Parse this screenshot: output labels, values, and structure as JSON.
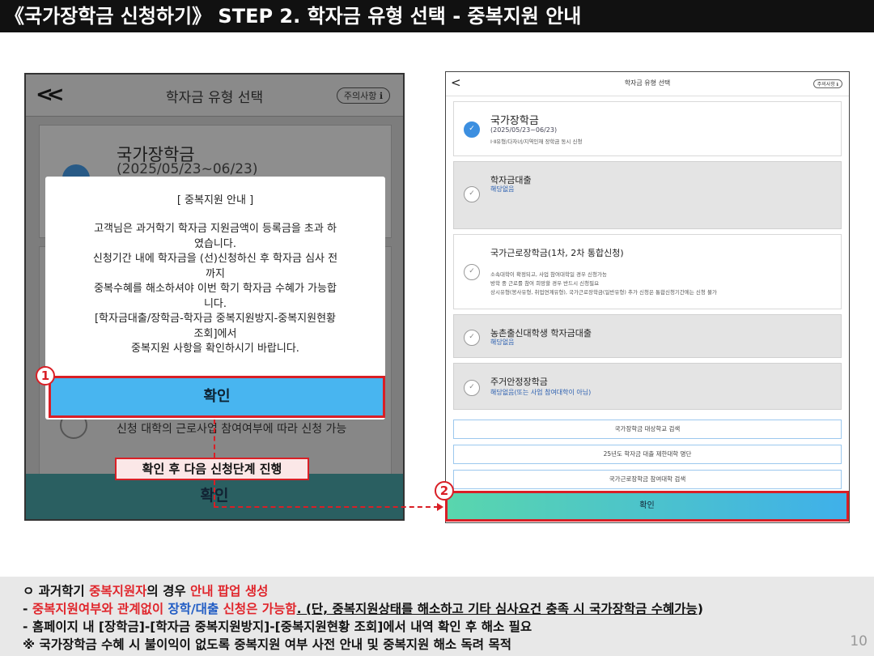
{
  "header": {
    "title": "《국가장학금 신청하기》 STEP 2. 학자금 유형 선택 - 중복지원 안내"
  },
  "left_screen": {
    "back": "<<",
    "title": "학자금 유형 선택",
    "notice_button": "주의사항 ℹ",
    "card_name": "국가장학금",
    "card_date": "(2025/05/23~06/23)",
    "bg_text": "신청 대학의 근로사업 참여여부에 따라 신청 가능",
    "bg_confirm": "확인",
    "modal": {
      "title": "[ 중복지원 안내 ]",
      "body_lines": [
        "고객님은 과거학기 학자금 지원금액이 등록금을 초과 하",
        "였습니다.",
        "신청기간 내에 학자금을 (선)신청하신 후 학자금 심사 전",
        "까지",
        "중복수혜를 해소하셔야 이번 학기 학자금 수혜가 가능합",
        "니다.",
        "[학자금대출/장학금-학자금 중복지원방지-중복지원현황",
        "조회]에서",
        "중복지원 사항을 확인하시기 바랍니다."
      ],
      "confirm": "확인"
    }
  },
  "annotations": {
    "badge1": "1",
    "badge2": "2",
    "callout": "확인 후 다음 신청단계 진행"
  },
  "right_screen": {
    "back": "<",
    "title": "학자금 유형 선택",
    "notice_button": "주의사항 ℹ",
    "cards": [
      {
        "name": "국가장학금",
        "sub": "(2025/05/23~06/23)",
        "desc": "Ⅰ·Ⅱ유형/다자녀/지역인재 장학금 동시 신청",
        "checked": true
      },
      {
        "name": "학자금대출",
        "sub": "해당없음",
        "checked": false
      },
      {
        "name": "국가근로장학금(1차, 2차 통합신청)",
        "desc_lines": [
          "소속대학이 확정되고, 사업 참여대학일 경우 신청가능",
          "방학 중 근로를 참여 희망할 경우 반드시 신청필요",
          "상시유형(봉사유형, 취업연계유형), 국가근로장학금(일반유형) 추가 신청은 통합신청기간에는 신청 불가"
        ],
        "checked": false
      },
      {
        "name": "농촌출신대학생 학자금대출",
        "sub": "해당없음",
        "checked": false
      },
      {
        "name": "주거안정장학금",
        "sub": "해당없음(또는 사업 참여대학이 아님)",
        "checked": false
      }
    ],
    "links": [
      "국가장학금 대상학교 검색",
      "25년도 학자금 대출 제한대학 명단",
      "국가근로장학금 참여대학 검색"
    ],
    "confirm": "확인"
  },
  "notes": {
    "l1": {
      "bullet": "ㅇ 과거학기 ",
      "a": "중복지원자",
      "b": "의 경우 ",
      "c": "안내 팝업 생성"
    },
    "l2": {
      "a": " - ",
      "b": "중복지원여부와 관계없이 ",
      "c": "장학/대출",
      "d": " 신청은 가능함",
      "e": ". (단, 중복지원상태를 해소하고 기타 심사요건 충족 시 ",
      "f": "국가장학금 수혜가능",
      "g": ")"
    },
    "l3": " - 홈페이지 내 [장학금]-[학자금 중복지원방지]-[중복지원현황 조회]에서 내역 확인 후 해소 필요",
    "l4": " ※ 국가장학금 수혜 시 불이익이 없도록 중복지원 여부 사전 안내 및 중복지원 해소 독려 목적"
  },
  "page_number": "10",
  "colors": {
    "accent_red": "#d91f26",
    "confirm_blue": "#48b5f0",
    "title_bg": "#111111"
  }
}
